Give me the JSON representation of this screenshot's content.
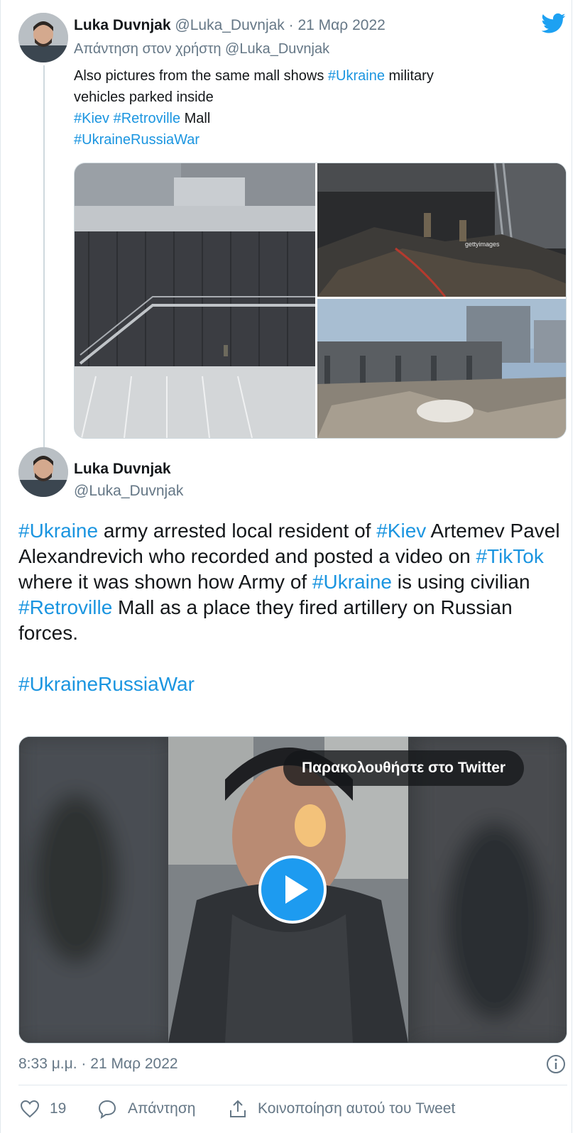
{
  "parent_tweet": {
    "name": "Luka Duvnjak",
    "handle": "@Luka_Duvnjak",
    "separator": "·",
    "date": "21 Μαρ 2022",
    "reply_context": "Απάντηση στον χρήστη @Luka_Duvnjak",
    "line1_pre": "Also pictures from the same mall shows ",
    "line1_tag": "#Ukraine",
    "line1_post": " military",
    "line2": "vehicles parked inside",
    "line3_tag1": "#Kiev",
    "line3_tag2": "#Retroville",
    "line3_post": " Mall",
    "line4_tag": "#UkraineRussiaWar",
    "photo_watermark": "gettyimages"
  },
  "main_tweet": {
    "name": "Luka Duvnjak",
    "handle": "@Luka_Duvnjak",
    "t1_tag": "#Ukraine",
    "t1_mid": " army arrested local resident of ",
    "t1_tag2": "#Kiev",
    "t1_post": " Artemev Pavel Alexandrevich who recorded and posted a video on ",
    "t1_tag3": "#TikTok",
    "t2_pre": "where it was shown how Army of ",
    "t2_tag": "#Ukraine",
    "t2_mid": " is using civilian ",
    "t2_tag2": "#Retroville",
    "t2_post": " Mall as a place they fired artillery on Russian forces.",
    "t3_tag": "#UkraineRussiaWar",
    "video_cta": "Παρακολουθήστε στο Twitter",
    "time": "8:33 μ.μ.",
    "separator": "·",
    "date": "21 Μαρ 2022"
  },
  "actions": {
    "like_count": "19",
    "reply_label": "Απάντηση",
    "share_label": "Κοινοποίηση αυτού του Tweet"
  },
  "colors": {
    "link": "#1b95e0",
    "muted": "#657786",
    "brand": "#1da1f2"
  },
  "icons": [
    "twitter-bird-icon",
    "play-icon",
    "info-icon",
    "heart-icon",
    "reply-bubble-icon",
    "share-icon"
  ]
}
